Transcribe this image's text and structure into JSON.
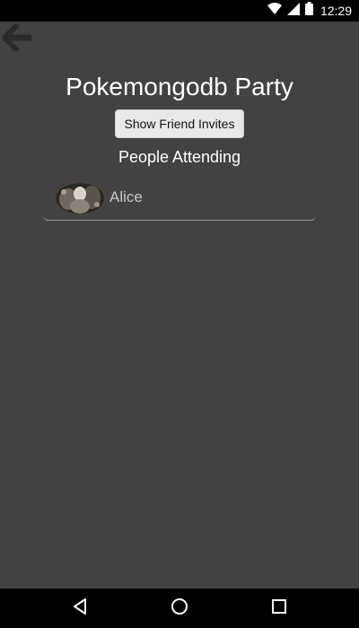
{
  "status_bar": {
    "time": "12:29",
    "icons": [
      "wifi-icon",
      "signal-icon",
      "battery-icon"
    ]
  },
  "header": {
    "back_icon": "back-arrow-icon",
    "title": "Pokemongodb Party"
  },
  "actions": {
    "invite_button_label": "Show Friend Invites"
  },
  "attendees": {
    "heading": "People Attending",
    "list": [
      {
        "name": "Alice",
        "avatar": "avatar-photo"
      }
    ]
  },
  "nav_bar": {
    "buttons": [
      "back-triangle-icon",
      "home-circle-icon",
      "recents-square-icon"
    ]
  },
  "colors": {
    "background": "#434141",
    "text": "#ffffff",
    "button_bg": "#e9e9e9",
    "system_bars": "#000000"
  }
}
